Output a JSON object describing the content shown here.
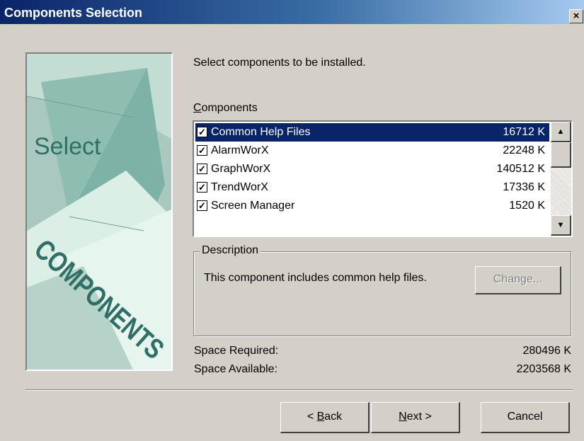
{
  "window": {
    "title": "Components Selection",
    "close_glyph": "×"
  },
  "art": {
    "select_text": "Select",
    "components_text": "COMPONENTS"
  },
  "instruction": "Select components to be installed.",
  "components_label": {
    "mnemonic": "C",
    "rest": "omponents"
  },
  "components": [
    {
      "name": "Common Help Files",
      "size": "16712 K",
      "checked": true,
      "selected": true
    },
    {
      "name": "AlarmWorX",
      "size": "22248 K",
      "checked": true,
      "selected": false
    },
    {
      "name": "GraphWorX",
      "size": "140512 K",
      "checked": true,
      "selected": false
    },
    {
      "name": "TrendWorX",
      "size": "17336 K",
      "checked": true,
      "selected": false
    },
    {
      "name": "Screen Manager",
      "size": "1520 K",
      "checked": true,
      "selected": false
    }
  ],
  "scrollbar": {
    "up_glyph": "▲",
    "down_glyph": "▼"
  },
  "description": {
    "legend": "Description",
    "text": "This component includes common help files.",
    "change_button": "Change..."
  },
  "space": {
    "required_label": "Space Required:",
    "required_value": "280496 K",
    "available_label": "Space Available:",
    "available_value": "2203568 K"
  },
  "buttons": {
    "back": {
      "prefix": "< ",
      "mnemonic": "B",
      "rest": "ack"
    },
    "next": {
      "mnemonic": "N",
      "rest": "ext >"
    },
    "cancel": "Cancel"
  },
  "colors": {
    "titlebar": "#0a246a",
    "selection": "#0a246a",
    "dialog": "#d4d0c8",
    "art_bg": "#9dbcb4"
  }
}
